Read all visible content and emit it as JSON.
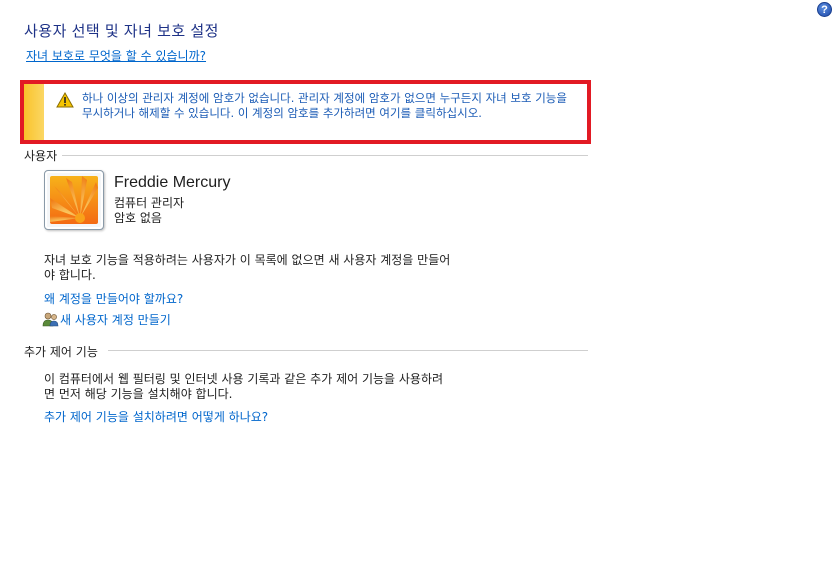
{
  "page": {
    "title": "사용자 선택 및 자녀 보호 설정",
    "help_link": "자녀 보호로 무엇을 할 수 있습니까?"
  },
  "warning": {
    "text": "하나 이상의 관리자 계정에 암호가 없습니다. 관리자 계정에 암호가 없으면 누구든지 자녀 보호 기능을 무시하거나 해제할 수 있습니다. 이 계정의 암호를 추가하려면 여기를 클릭하십시오."
  },
  "users_section": {
    "label": "사용자",
    "users": [
      {
        "name": "Freddie Mercury",
        "role": "컴퓨터 관리자",
        "password_status": "암호 없음"
      }
    ],
    "description": "자녀 보호 기능을 적용하려는 사용자가 이 목록에 없으면 새 사용자 계정을 만들어야 합니다.",
    "why_link": "왜 계정을 만들어야 할까요?",
    "create_link": "새 사용자 계정 만들기"
  },
  "controls_section": {
    "label": "추가 제어 기능",
    "description": "이 컴퓨터에서 웹 필터링 및 인터넷 사용 기록과 같은 추가 제어 기능을 사용하려면 먼저 해당 기능을 설치해야 합니다.",
    "install_link": "추가 제어 기능을 설치하려면 어떻게 하나요?"
  },
  "colors": {
    "title": "#1e3287",
    "link": "#0066cc",
    "warning_border": "#e21a24",
    "warning_stripe": "#f9c32b"
  },
  "icons": [
    "help-icon",
    "warning-icon",
    "user-avatar-flower",
    "users-add-icon"
  ]
}
